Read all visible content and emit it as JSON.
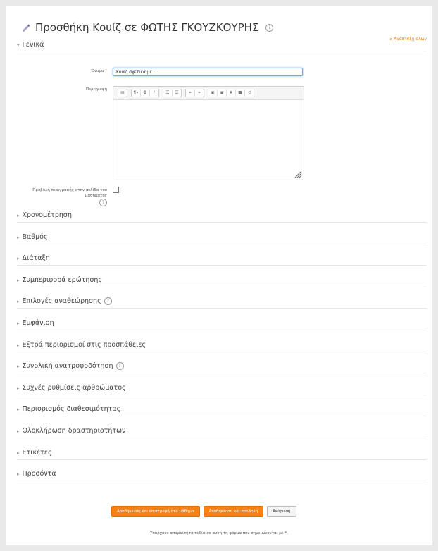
{
  "header": {
    "title": "Προσθήκη Κουίζ σε ΦΩΤΗΣ ΓΚΟΥΖΚΟΥΡΗΣ",
    "help_glyph": "?",
    "expand_all_label": "Ανάπτυξη όλων"
  },
  "general": {
    "section_title": "Γενικά",
    "name_label": "Όνομα",
    "required_marker": "*",
    "name_value": "Κουίζ σχετικά με...",
    "description_label": "Περιγραφή",
    "show_description_label_line1": "Προβολή περιγραφής στην σελίδα του",
    "show_description_label_line2": "μαθήματος",
    "show_description_checked": false
  },
  "editor": {
    "toolbar_buttons": [
      "▤",
      "¶▾",
      "B",
      "I",
      "☰",
      "☰",
      "⚭",
      "⚭",
      "▣",
      "▣",
      "♦",
      "■",
      "⟲"
    ]
  },
  "sections": [
    {
      "label": "Χρονομέτρηση",
      "help": false
    },
    {
      "label": "Βαθμός",
      "help": false
    },
    {
      "label": "Διάταξη",
      "help": false
    },
    {
      "label": "Συμπεριφορά ερώτησης",
      "help": false
    },
    {
      "label": "Επιλογές αναθεώρησης",
      "help": true
    },
    {
      "label": "Εμφάνιση",
      "help": false
    },
    {
      "label": "Εξτρά περιορισμοί στις προσπάθειες",
      "help": false
    },
    {
      "label": "Συνολική ανατροφοδότηση",
      "help": true
    },
    {
      "label": "Συχνές ρυθμίσεις αρθρώματος",
      "help": false
    },
    {
      "label": "Περιορισμός διαθεσιμότητας",
      "help": false
    },
    {
      "label": "Ολοκλήρωση δραστηριοτήτων",
      "help": false
    },
    {
      "label": "Ετικέτες",
      "help": false
    },
    {
      "label": "Προσόντα",
      "help": false
    }
  ],
  "actions": {
    "save_return_label": "Αποθήκευση και επιστροφή στο μάθημα",
    "save_display_label": "Αποθήκευση και προβολή",
    "cancel_label": "Ακύρωση"
  },
  "footnote": "Υπάρχουν απαραίτητα πεδία σε αυτή τη φόρμα που σημειώνονται με *.",
  "colors": {
    "accent": "#f98012",
    "required": "#d9534f",
    "focus": "#7fa8d8"
  }
}
